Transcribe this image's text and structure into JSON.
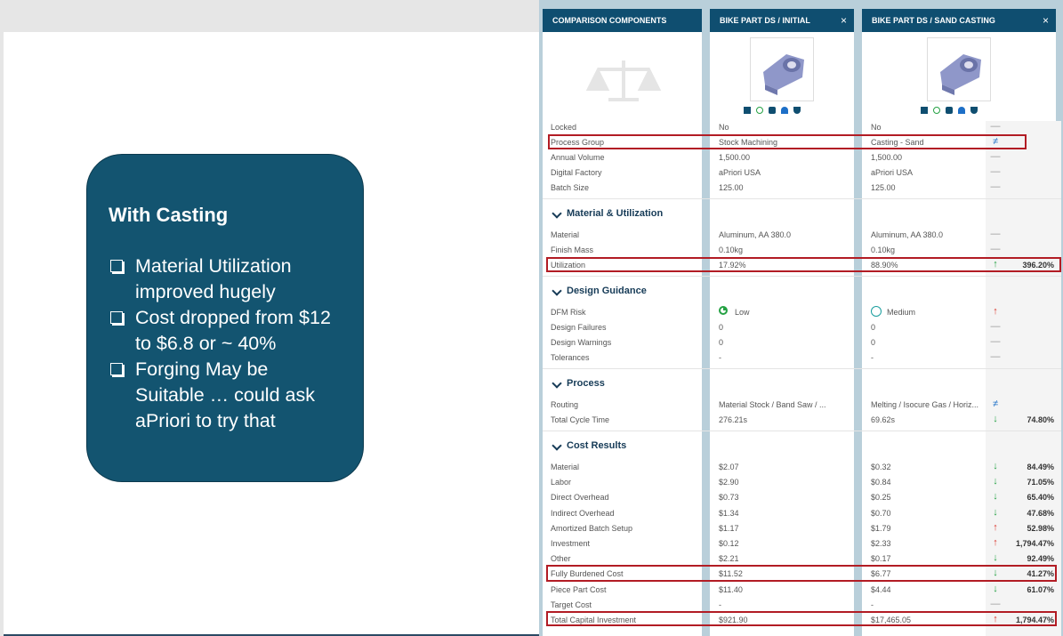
{
  "slide": {
    "callout_title": "With Casting",
    "bullets": [
      "Material Utilization improved hugely",
      "Cost dropped from $12 to $6.8 or ~ 40%",
      "Forging May be Suitable … could ask aPriori to try that"
    ]
  },
  "columns": [
    {
      "title": "COMPARISON COMPONENTS"
    },
    {
      "title": "BIKE PART DS / INITIAL",
      "close": "×"
    },
    {
      "title": "BIKE PART DS / SAND CASTING",
      "close": "×"
    }
  ],
  "sections": {
    "material": "Material & Utilization",
    "design": "Design Guidance",
    "process": "Process",
    "cost": "Cost Results"
  },
  "rows": {
    "locked": {
      "label": "Locked",
      "a": "No",
      "b": "No",
      "diff": "—",
      "pct": ""
    },
    "process_group": {
      "label": "Process Group",
      "a": "Stock Machining",
      "b": "Casting - Sand",
      "diff": "≠",
      "pct": ""
    },
    "annual_volume": {
      "label": "Annual Volume",
      "a": "1,500.00",
      "b": "1,500.00",
      "diff": "—",
      "pct": ""
    },
    "digital_factory": {
      "label": "Digital Factory",
      "a": "aPriori USA",
      "b": "aPriori USA",
      "diff": "—",
      "pct": ""
    },
    "batch_size": {
      "label": "Batch Size",
      "a": "125.00",
      "b": "125.00",
      "diff": "—",
      "pct": ""
    },
    "material": {
      "label": "Material",
      "a": "Aluminum, AA 380.0",
      "b": "Aluminum, AA 380.0",
      "diff": "—",
      "pct": ""
    },
    "finish_mass": {
      "label": "Finish Mass",
      "a": "0.10kg",
      "b": "0.10kg",
      "diff": "—",
      "pct": ""
    },
    "utilization": {
      "label": "Utilization",
      "a": "17.92%",
      "b": "88.90%",
      "diff": "↑",
      "pct": "396.20%"
    },
    "dfm_risk": {
      "label": "DFM Risk",
      "a": "Low",
      "b": "Medium",
      "diff": "↑",
      "pct": ""
    },
    "design_failures": {
      "label": "Design Failures",
      "a": "0",
      "b": "0",
      "diff": "—",
      "pct": ""
    },
    "design_warnings": {
      "label": "Design Warnings",
      "a": "0",
      "b": "0",
      "diff": "—",
      "pct": ""
    },
    "tolerances": {
      "label": "Tolerances",
      "a": "-",
      "b": "-",
      "diff": "—",
      "pct": ""
    },
    "routing": {
      "label": "Routing",
      "a": "Material Stock / Band Saw / ...",
      "b": "Melting / Isocure Gas / Horiz...",
      "diff": "≠",
      "pct": ""
    },
    "cycle_time": {
      "label": "Total Cycle Time",
      "a": "276.21s",
      "b": "69.62s",
      "diff": "↓",
      "pct": "74.80%"
    },
    "c_material": {
      "label": "Material",
      "a": "$2.07",
      "b": "$0.32",
      "diff": "↓",
      "pct": "84.49%"
    },
    "labor": {
      "label": "Labor",
      "a": "$2.90",
      "b": "$0.84",
      "diff": "↓",
      "pct": "71.05%"
    },
    "direct_overhead": {
      "label": "Direct Overhead",
      "a": "$0.73",
      "b": "$0.25",
      "diff": "↓",
      "pct": "65.40%"
    },
    "indirect_overhead": {
      "label": "Indirect Overhead",
      "a": "$1.34",
      "b": "$0.70",
      "diff": "↓",
      "pct": "47.68%"
    },
    "amortized": {
      "label": "Amortized Batch Setup",
      "a": "$1.17",
      "b": "$1.79",
      "diff": "↑",
      "pct": "52.98%"
    },
    "investment": {
      "label": "Investment",
      "a": "$0.12",
      "b": "$2.33",
      "diff": "↑",
      "pct": "1,794.47%"
    },
    "other": {
      "label": "Other",
      "a": "$2.21",
      "b": "$0.17",
      "diff": "↓",
      "pct": "92.49%"
    },
    "fbc": {
      "label": "Fully Burdened Cost",
      "a": "$11.52",
      "b": "$6.77",
      "diff": "↓",
      "pct": "41.27%"
    },
    "piece_part": {
      "label": "Piece Part Cost",
      "a": "$11.40",
      "b": "$4.44",
      "diff": "↓",
      "pct": "61.07%"
    },
    "target_cost": {
      "label": "Target Cost",
      "a": "-",
      "b": "-",
      "diff": "—",
      "pct": ""
    },
    "capital": {
      "label": "Total Capital Investment",
      "a": "$921.90",
      "b": "$17,465.05",
      "diff": "↑",
      "pct": "1,794.47%"
    }
  },
  "colors": {
    "header": "#0f4e70",
    "callout": "#135470",
    "highlight": "#b21c24",
    "up": "#d9342b",
    "down": "#25a244"
  }
}
